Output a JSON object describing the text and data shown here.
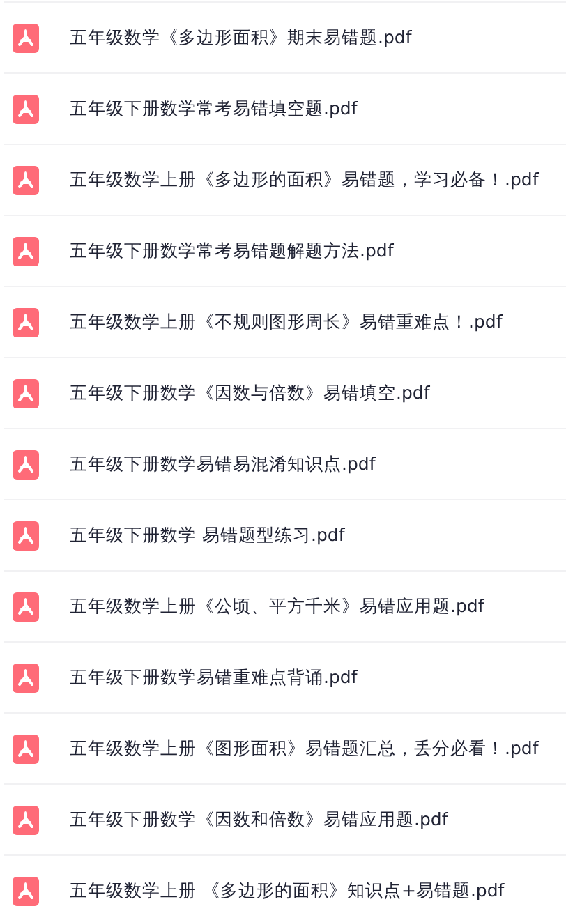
{
  "files": [
    {
      "name": "五年级数学《多边形面积》期末易错题.pdf"
    },
    {
      "name": "五年级下册数学常考易错填空题.pdf"
    },
    {
      "name": "五年级数学上册《多边形的面积》易错题，学习必备！.pdf"
    },
    {
      "name": "五年级下册数学常考易错题解题方法.pdf"
    },
    {
      "name": "五年级数学上册《不规则图形周长》易错重难点！.pdf"
    },
    {
      "name": "五年级下册数学《因数与倍数》易错填空.pdf"
    },
    {
      "name": "五年级下册数学易错易混淆知识点.pdf"
    },
    {
      "name": "五年级下册数学 易错题型练习.pdf"
    },
    {
      "name": "五年级数学上册《公顷、平方千米》易错应用题.pdf"
    },
    {
      "name": "五年级下册数学易错重难点背诵.pdf"
    },
    {
      "name": "五年级数学上册《图形面积》易错题汇总，丢分必看！.pdf"
    },
    {
      "name": "五年级下册数学《因数和倍数》易错应用题.pdf"
    },
    {
      "name": "五年级数学上册 《多边形的面积》知识点+易错题.pdf"
    }
  ]
}
